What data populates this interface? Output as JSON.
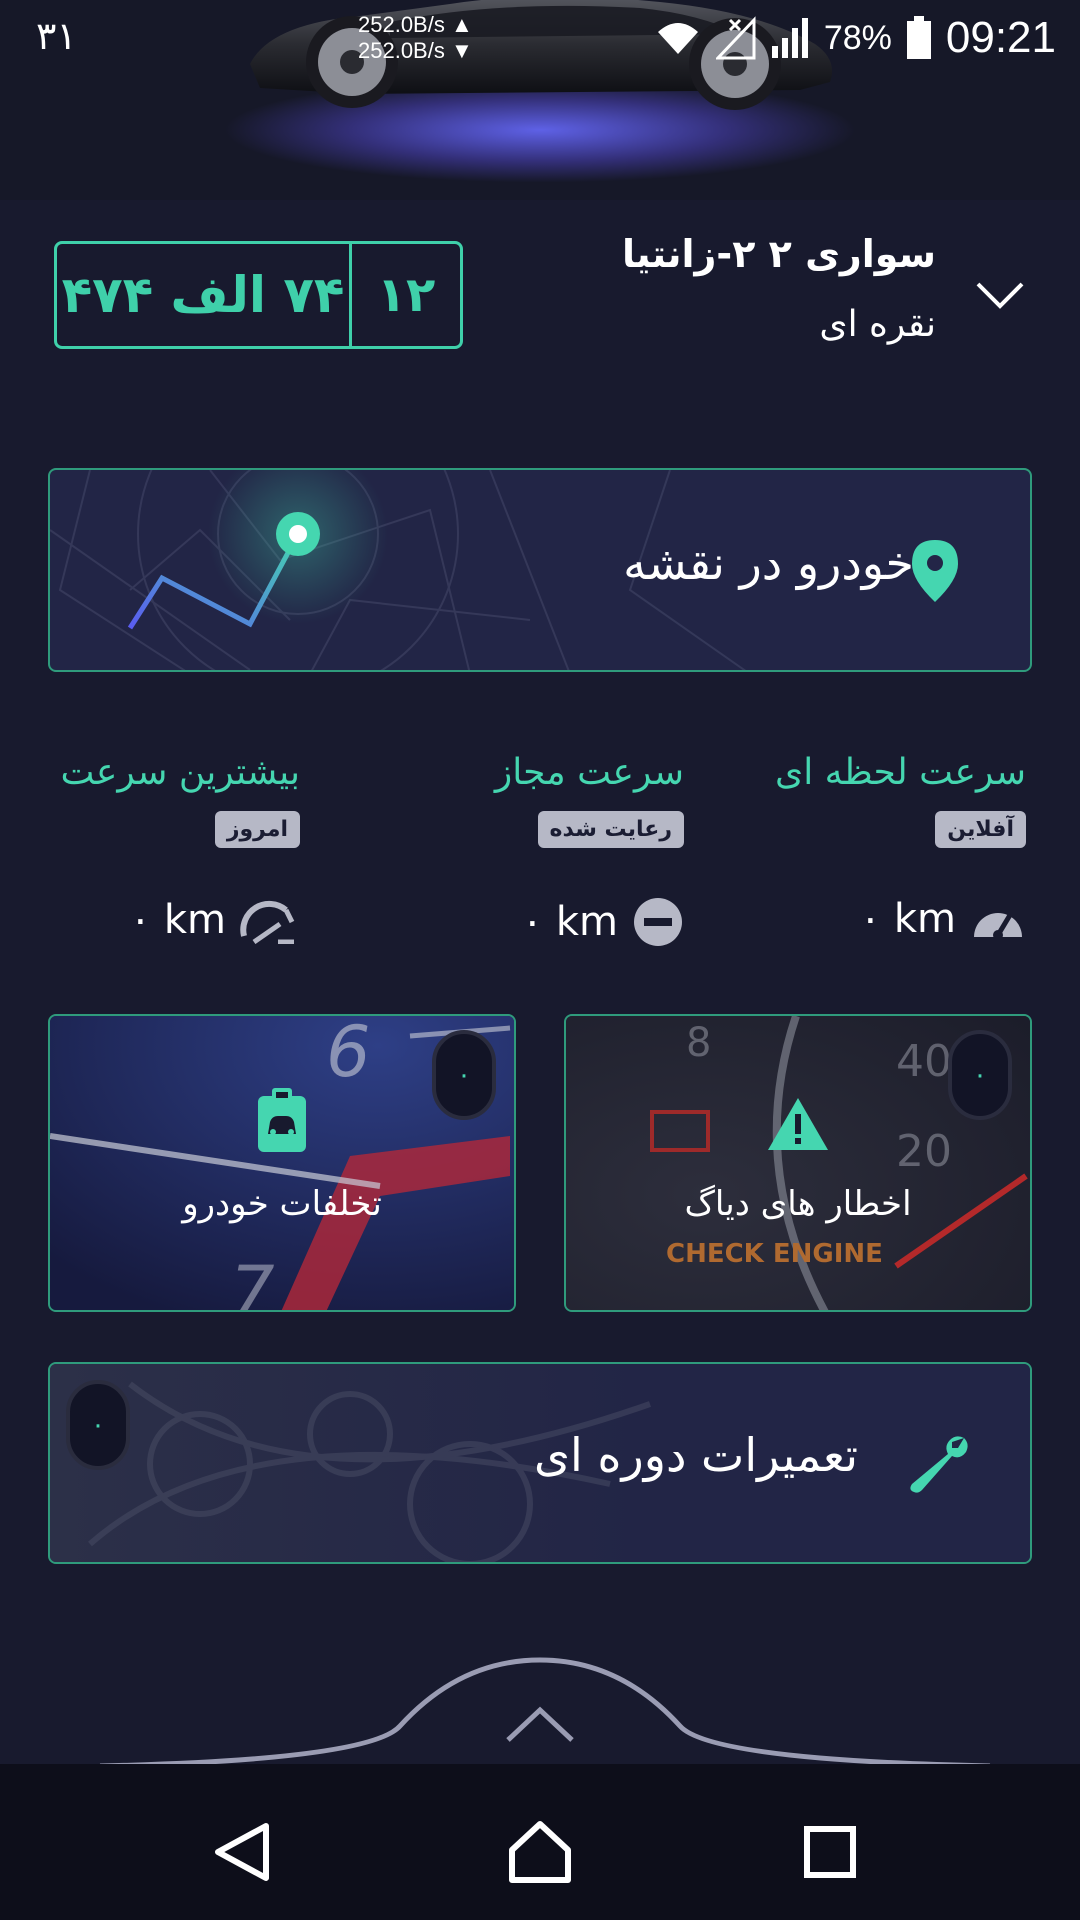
{
  "status_bar": {
    "left_text": "۳۱",
    "net_up": "252.0B/s ▲",
    "net_down": "252.0B/s ▼",
    "battery_percent": "78%",
    "time": "09:21",
    "icons": [
      "wifi-icon",
      "signal-off-icon",
      "cell-signal-icon",
      "battery-icon"
    ]
  },
  "vehicle": {
    "name": "سواری ۲ ۲-زانتیا",
    "color": "نقره ای",
    "plate": {
      "region": "۱۲",
      "number": "۷۴ الف ۴۷۴"
    }
  },
  "map_card": {
    "title": "خودرو در نقشه"
  },
  "speeds": [
    {
      "title": "سرعت لحظه ای",
      "badge": "آفلاین",
      "value": "۰ km",
      "icon": "speedometer-icon"
    },
    {
      "title": "سرعت مجاز",
      "badge": "رعایت شده",
      "value": "۰ km",
      "icon": "minus-circle-icon"
    },
    {
      "title": "بیشترین سرعت",
      "badge": "امروز",
      "value": "۰ km",
      "icon": "gauge-max-icon"
    }
  ],
  "tiles": {
    "violations": {
      "label": "تخلفات خودرو",
      "count": "۰"
    },
    "diag": {
      "label": "اخطار های دیاگ",
      "count": "۰"
    }
  },
  "repair_card": {
    "title": "تعمیرات دوره ای",
    "count": "۰"
  },
  "decor_text": {
    "check_engine": "CHECK ENGINE",
    "gauge_digits": [
      "8",
      "40",
      "20",
      "6",
      "7"
    ]
  },
  "colors": {
    "accent": "#45d6b0",
    "background": "#181a2e",
    "card": "#222546",
    "glow": "#6265f0"
  }
}
